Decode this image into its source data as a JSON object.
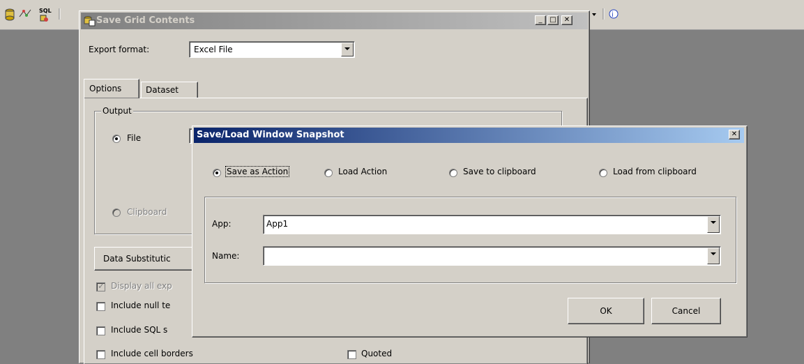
{
  "toolbar": {
    "icon_sql_label": "SQL"
  },
  "save_grid": {
    "title": "Save Grid Contents",
    "export_format_label": "Export format:",
    "export_format_value": "Excel File",
    "tabs": [
      {
        "label": "Options"
      },
      {
        "label": "Dataset"
      }
    ],
    "output_group_label": "Output",
    "radio_file_label": "File",
    "radio_clipboard_label": "Clipboard",
    "data_substitution_label": "Data Substitutic",
    "display_all_label": "Display all exp",
    "include_null_label": "Include null te",
    "include_sql_label": "Include SQL s",
    "include_borders_label": "Include cell borders",
    "quoted_label": "Quoted"
  },
  "snapshot": {
    "title": "Save/Load Window Snapshot",
    "options": [
      {
        "label": "Save as Action",
        "selected": true
      },
      {
        "label": "Load Action",
        "selected": false
      },
      {
        "label": "Save to clipboard",
        "selected": false
      },
      {
        "label": "Load from clipboard",
        "selected": false
      }
    ],
    "app_label": "App:",
    "app_value": "App1",
    "name_label": "Name:",
    "name_value": "",
    "ok_label": "OK",
    "cancel_label": "Cancel"
  },
  "colors": {
    "title_active_start": "#0a246a",
    "title_active_end": "#a6caf0",
    "title_inactive": "#808080",
    "face": "#d4d0c8",
    "desktop": "#808080"
  }
}
